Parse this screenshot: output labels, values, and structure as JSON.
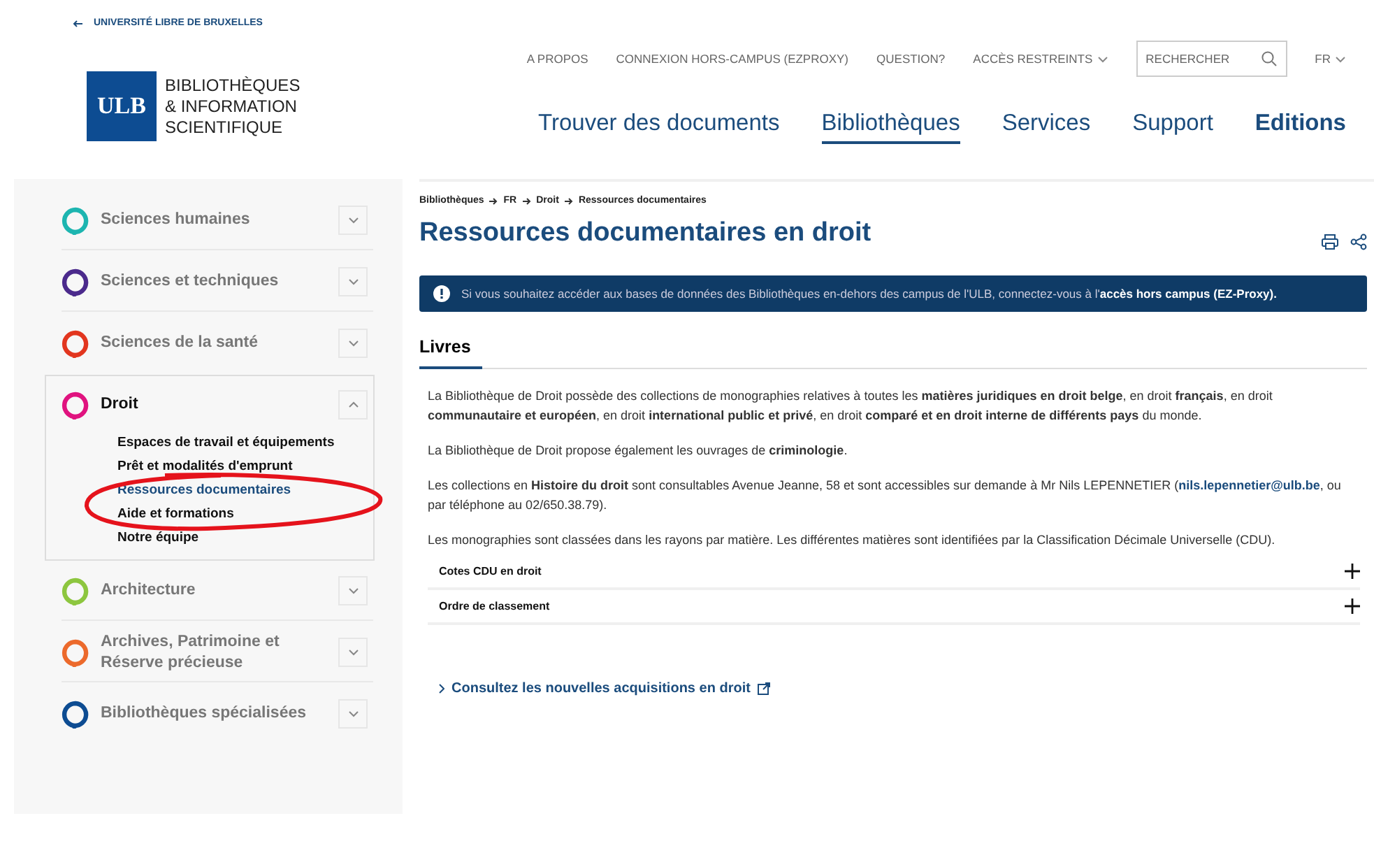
{
  "back_link": "UNIVERSITÉ LIBRE DE BRUXELLES",
  "logo": {
    "mark": "ULB",
    "lines": [
      "BIBLIOTHÈQUES",
      "& INFORMATION",
      "SCIENTIFIQUE"
    ]
  },
  "utility_nav": [
    {
      "label": "A PROPOS",
      "dropdown": false
    },
    {
      "label": "CONNEXION HORS-CAMPUS (EZPROXY)",
      "dropdown": false
    },
    {
      "label": "QUESTION?",
      "dropdown": false
    },
    {
      "label": "ACCÈS RESTREINTS",
      "dropdown": true
    }
  ],
  "search": {
    "placeholder": "RECHERCHER"
  },
  "language": "FR",
  "main_nav": [
    {
      "label": "Trouver des documents",
      "selected": false,
      "bold": false
    },
    {
      "label": "Bibliothèques",
      "selected": true,
      "bold": false
    },
    {
      "label": "Services",
      "selected": false,
      "bold": false
    },
    {
      "label": "Support",
      "selected": false,
      "bold": false
    },
    {
      "label": "Editions",
      "selected": false,
      "bold": true
    }
  ],
  "sidebar": {
    "items": [
      {
        "label": "Sciences humaines",
        "color": "#1db5b0",
        "expanded": false
      },
      {
        "label": "Sciences et techniques",
        "color": "#4b2a8c",
        "expanded": false
      },
      {
        "label": "Sciences de la santé",
        "color": "#e2361f",
        "expanded": false
      },
      {
        "label": "Droit",
        "color": "#e0137f",
        "expanded": true,
        "children": [
          {
            "label": "Espaces de travail et équipements",
            "selected": false
          },
          {
            "label": "Prêt et modalités d'emprunt",
            "selected": false
          },
          {
            "label": "Ressources documentaires",
            "selected": true
          },
          {
            "label": "Aide et formations",
            "selected": false
          },
          {
            "label": "Notre équipe",
            "selected": false
          }
        ]
      },
      {
        "label": "Architecture",
        "color": "#8dc63f",
        "expanded": false
      },
      {
        "label": "Archives, Patrimoine et Réserve précieuse",
        "color": "#ec6a2c",
        "expanded": false
      },
      {
        "label": "Bibliothèques spécialisées",
        "color": "#0d4c92",
        "expanded": false
      }
    ]
  },
  "breadcrumb": [
    "Bibliothèques",
    "FR",
    "Droit",
    "Ressources documentaires"
  ],
  "page_title": "Ressources documentaires en droit",
  "alert": {
    "text": "Si vous souhaitez accéder aux bases de données des Bibliothèques en-dehors des campus de l'ULB, connectez-vous à l'",
    "link": "accès hors campus (EZ-Proxy)."
  },
  "section_tab": "Livres",
  "paragraphs": [
    {
      "text": "La Bibliothèque de Droit possède des collections de monographies relatives à toutes les **matières juridiques en droit belge**, en droit **français**, en droit **communautaire et européen**, en droit **international public et privé**, en droit **comparé et en droit interne de différents pays** du monde."
    },
    {
      "text": "La Bibliothèque de Droit propose également les ouvrages de **criminologie**."
    },
    {
      "text": "Les collections en **Histoire du droit** sont consultables Avenue Jeanne, 58 et sont accessibles sur demande à Mr Nils LEPENNETIER (",
      "link": "nils.lepennetier@ulb.be",
      "after": ", ou par téléphone au 02/650.38.79)."
    },
    {
      "text": "Les monographies sont classées dans les rayons par matière. Les différentes matières sont identifiées par la Classification Décimale Universelle (CDU)."
    }
  ],
  "accordion": [
    {
      "label": "Cotes CDU en droit",
      "expanded": false
    },
    {
      "label": "Ordre de classement",
      "expanded": false
    }
  ],
  "external_link": "Consultez les nouvelles acquisitions en droit"
}
